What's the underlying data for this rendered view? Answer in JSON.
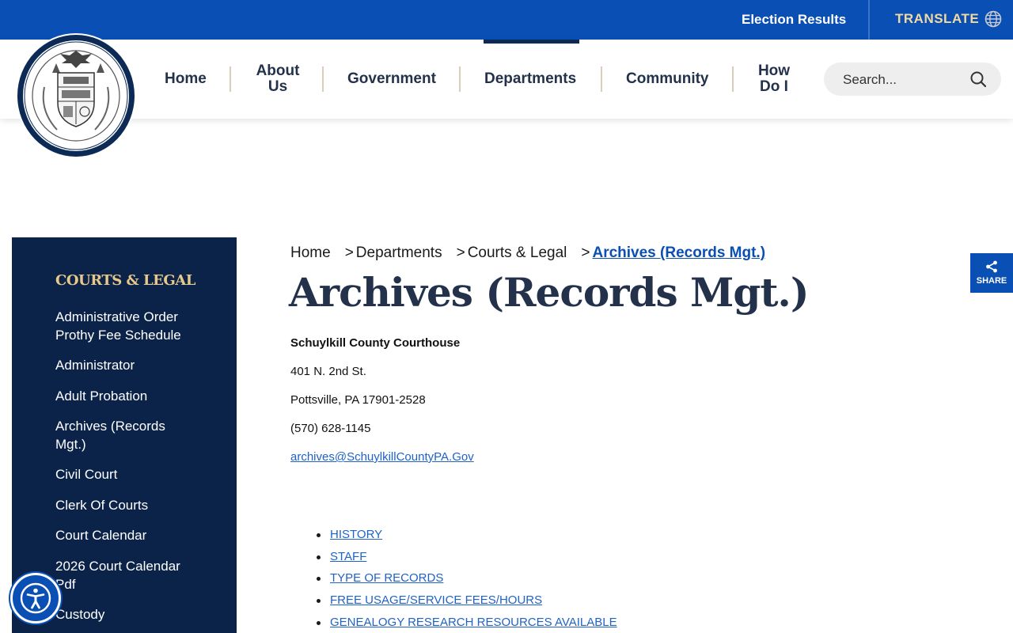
{
  "topbar": {
    "election_results": "Election Results",
    "translate": "TRANSLATE",
    "globe_icon": "globe-icon"
  },
  "header": {
    "seal_alt": "Seal of Schuylkill County",
    "seal_text_top": "SEAL OF SCHUYLKILL COUNTY 1811",
    "seal_text_bottom": "PENNSYLVANIA",
    "nav": {
      "home": "Home",
      "about_l1": "About",
      "about_l2": "Us",
      "government": "Government",
      "departments": "Departments",
      "community": "Community",
      "howdoi_l1": "How",
      "howdoi_l2": "Do I"
    },
    "active_nav": "Departments",
    "search": {
      "placeholder": "Search...",
      "icon": "search-icon"
    }
  },
  "sidebar": {
    "title": "COURTS & LEGAL",
    "items": [
      "Administrative Order Prothy Fee Schedule",
      "Administrator",
      "Adult Probation",
      "Archives (Records Mgt.)",
      "Civil Court",
      "Clerk Of Courts",
      "Court Calendar",
      "2026 Court Calendar Pdf",
      "Custody"
    ]
  },
  "breadcrumb": {
    "home": "Home",
    "sep": ">",
    "departments": "Departments",
    "courts": "Courts & Legal",
    "current": "Archives (Records Mgt.)"
  },
  "main": {
    "title": "Archives (Records Mgt.)",
    "org": "Schuylkill County Courthouse",
    "address1": "401 N. 2nd St.",
    "address2": "Pottsville, PA 17901-2528",
    "phone": "(570) 628-1145",
    "email": "archives@SchuylkillCountyPA.Gov",
    "toc": [
      "HISTORY",
      "STAFF",
      "TYPE OF RECORDS",
      "FREE USAGE/SERVICE FEES/HOURS",
      "GENEALOGY RESEARCH RESOURCES AVAILABLE"
    ]
  },
  "share": {
    "label": "SHARE",
    "icon": "share-icon"
  },
  "accessibility": {
    "icon": "accessibility-icon"
  },
  "colors": {
    "brand_blue": "#0a4fb4",
    "navy": "#0c2349",
    "gold": "#e7c98a",
    "title_navy": "#23324a"
  }
}
